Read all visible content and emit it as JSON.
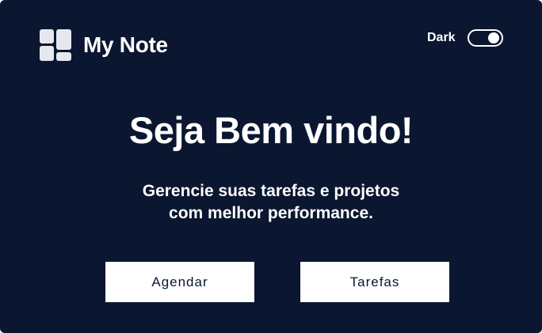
{
  "header": {
    "app_title": "My Note",
    "logo_icon": "grid-blocks-icon",
    "theme_label": "Dark",
    "theme_toggle_on": true
  },
  "hero": {
    "headline": "Seja Bem vindo!",
    "subtitle_line1": "Gerencie suas tarefas e projetos",
    "subtitle_line2": "com melhor performance."
  },
  "actions": {
    "agendar_label": "Agendar",
    "tarefas_label": "Tarefas"
  },
  "colors": {
    "background": "#0b1630",
    "foreground": "#ffffff",
    "button_text": "#0b1630"
  }
}
